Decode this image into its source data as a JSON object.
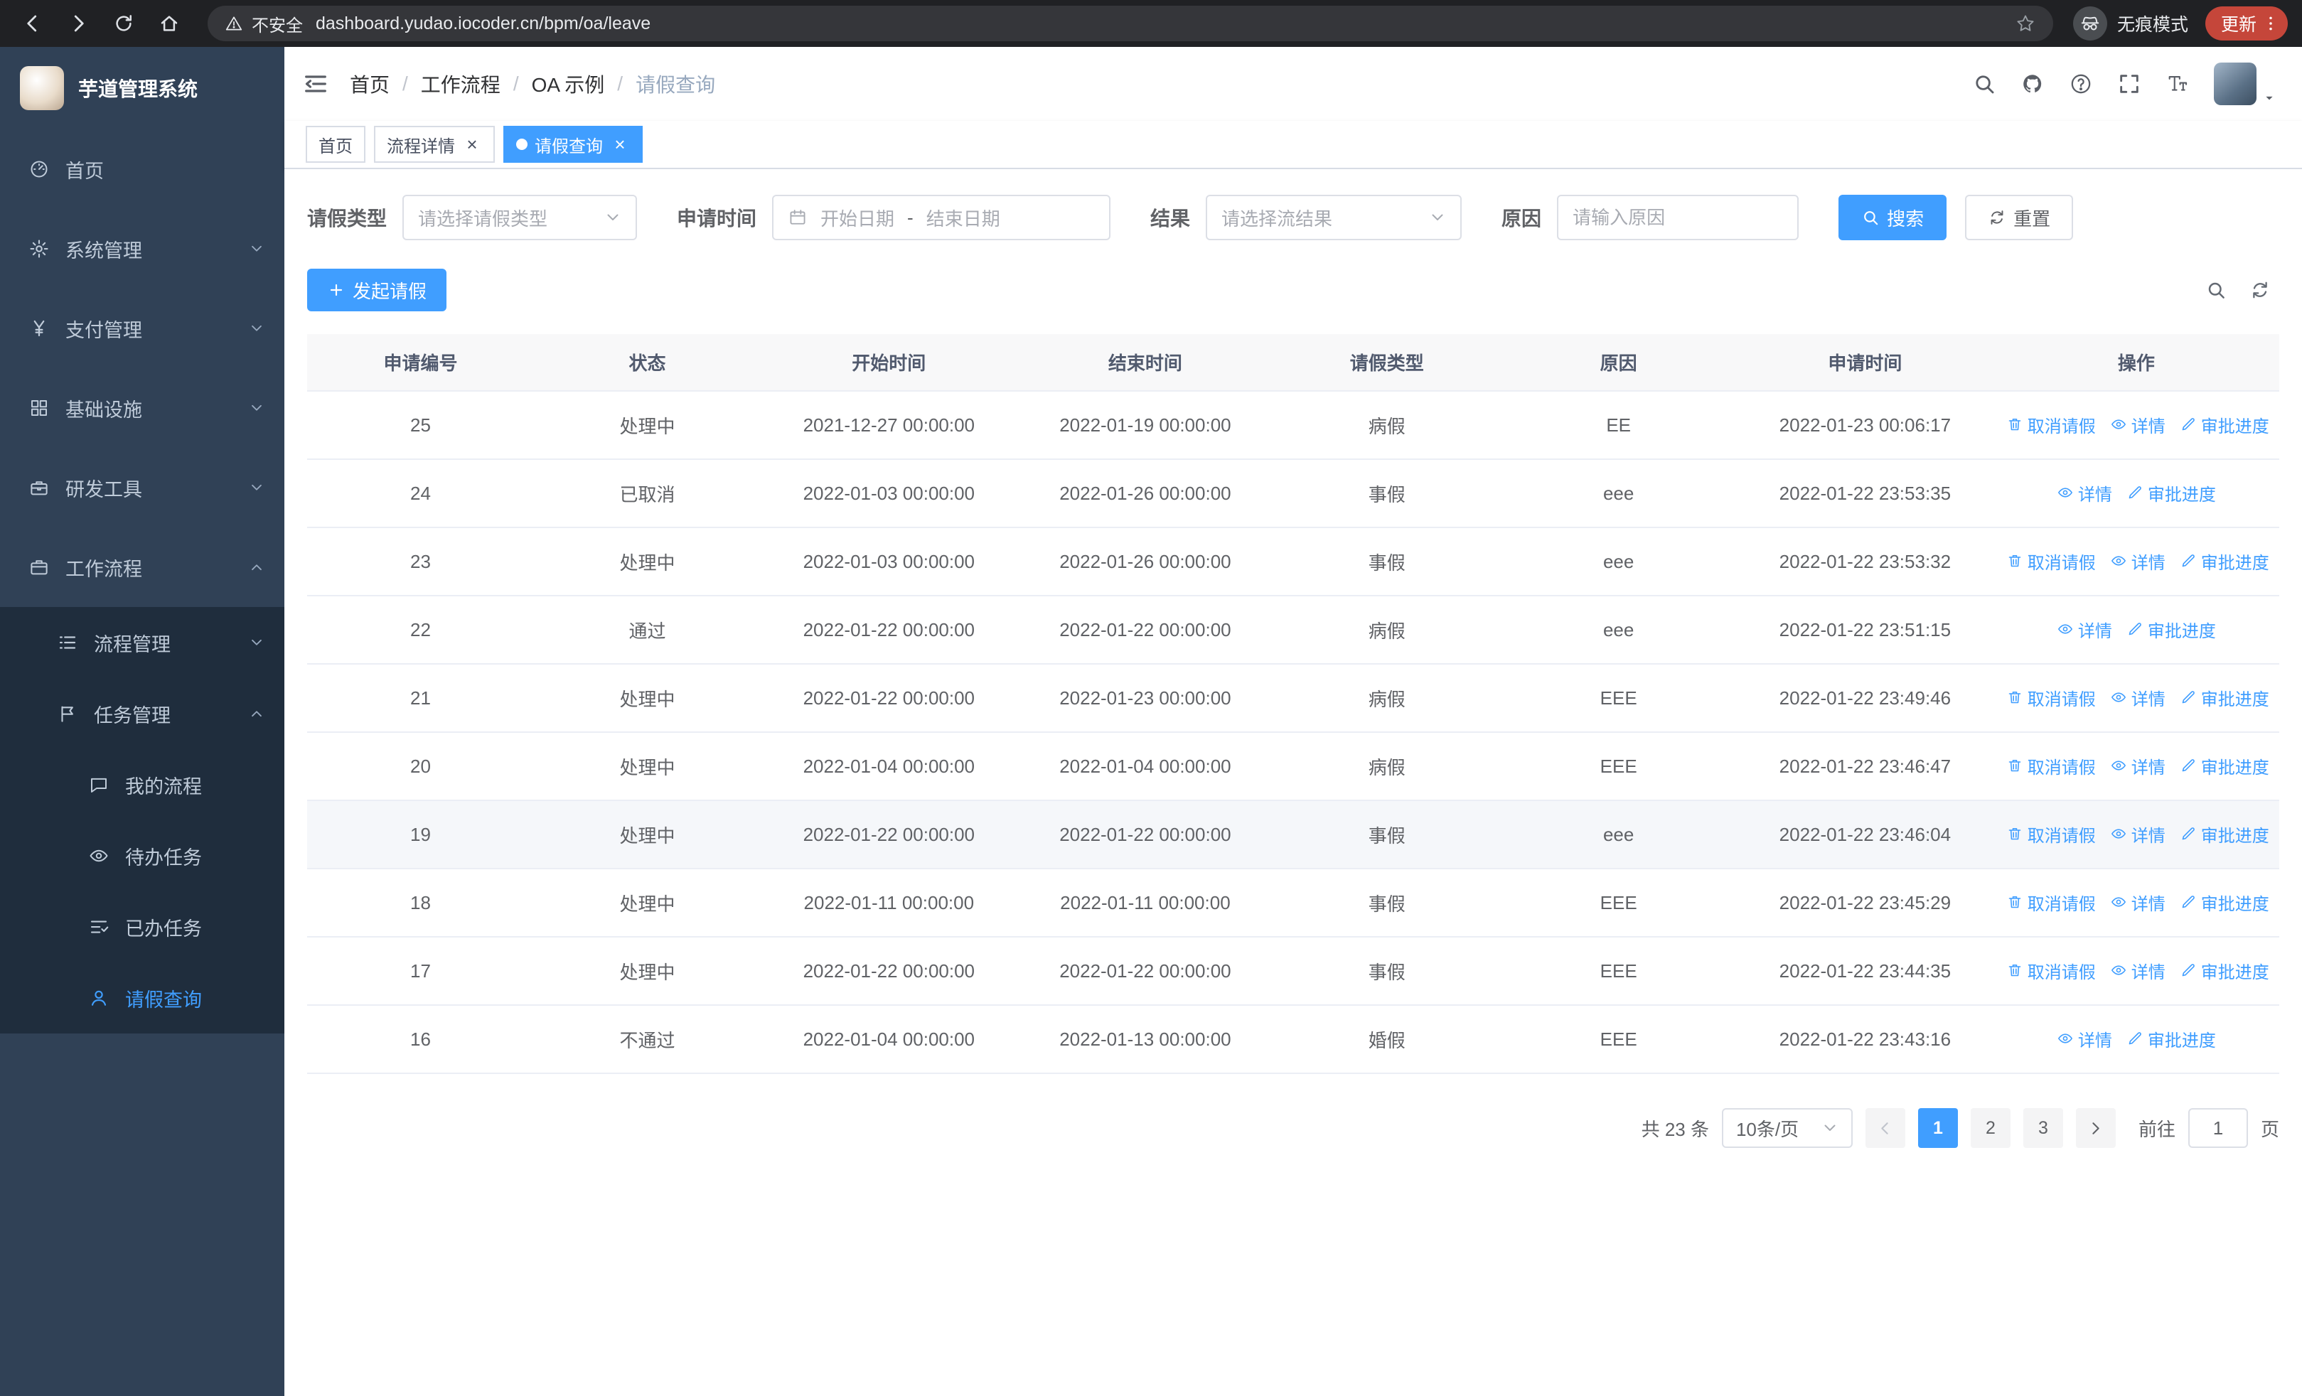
{
  "colors": {
    "primary": "#409eff",
    "sidebar_bg": "#304156",
    "sidebar_submenu_bg": "#1f2d3d",
    "update_badge_bg": "#c5463a"
  },
  "browser": {
    "security_label": "不安全",
    "url": "dashboard.yudao.iocoder.cn/bpm/oa/leave",
    "incognito_label": "无痕模式",
    "update_label": "更新"
  },
  "sidebar": {
    "app_title": "芋道管理系统",
    "menu": [
      {
        "key": "home",
        "label": "首页",
        "icon": "dashboard-icon"
      },
      {
        "key": "system",
        "label": "系统管理",
        "icon": "gear-icon",
        "chevron": "down"
      },
      {
        "key": "payment",
        "label": "支付管理",
        "icon": "yen-icon",
        "chevron": "down"
      },
      {
        "key": "infrastructure",
        "label": "基础设施",
        "icon": "grid-icon",
        "chevron": "down"
      },
      {
        "key": "dev-tools",
        "label": "研发工具",
        "icon": "toolbox-icon",
        "chevron": "down"
      },
      {
        "key": "workflow",
        "label": "工作流程",
        "icon": "briefcase-icon",
        "chevron": "up",
        "expanded": true,
        "children": [
          {
            "key": "process-management",
            "label": "流程管理",
            "icon": "list-icon",
            "chevron": "down"
          },
          {
            "key": "task-management",
            "label": "任务管理",
            "icon": "flag-icon",
            "chevron": "up",
            "expanded": true,
            "children": [
              {
                "key": "my-process",
                "label": "我的流程",
                "icon": "chat-icon"
              },
              {
                "key": "todo-task",
                "label": "待办任务",
                "icon": "eye-icon"
              },
              {
                "key": "done-task",
                "label": "已办任务",
                "icon": "done-icon"
              },
              {
                "key": "leave-query",
                "label": "请假查询",
                "icon": "user-icon",
                "active": true
              }
            ]
          }
        ]
      }
    ]
  },
  "navbar": {
    "breadcrumb": [
      {
        "label": "首页"
      },
      {
        "label": "工作流程"
      },
      {
        "label": "OA 示例"
      },
      {
        "label": "请假查询",
        "current": true
      }
    ]
  },
  "tags_view": [
    {
      "key": "home",
      "label": "首页",
      "closable": false,
      "active": false
    },
    {
      "key": "process-detail",
      "label": "流程详情",
      "closable": true,
      "active": false
    },
    {
      "key": "leave-query",
      "label": "请假查询",
      "closable": true,
      "active": true
    }
  ],
  "filters": {
    "leave_type_label": "请假类型",
    "leave_type_placeholder": "请选择请假类型",
    "apply_time_label": "申请时间",
    "start_date_placeholder": "开始日期",
    "date_separator": "-",
    "end_date_placeholder": "结束日期",
    "result_label": "结果",
    "result_placeholder": "请选择流结果",
    "reason_label": "原因",
    "reason_placeholder": "请输入原因",
    "search_label": "搜索",
    "reset_label": "重置"
  },
  "actions_bar": {
    "create_label": "发起请假"
  },
  "table": {
    "headers": [
      "申请编号",
      "状态",
      "开始时间",
      "结束时间",
      "请假类型",
      "原因",
      "申请时间",
      "操作"
    ],
    "action_labels": {
      "cancel": "取消请假",
      "detail": "详情",
      "progress": "审批进度"
    },
    "rows": [
      {
        "id": "25",
        "status": "处理中",
        "start": "2021-12-27 00:00:00",
        "end": "2022-01-19 00:00:00",
        "type": "病假",
        "reason": "EE",
        "applied": "2022-01-23 00:06:17",
        "actions": [
          "cancel",
          "detail",
          "progress"
        ]
      },
      {
        "id": "24",
        "status": "已取消",
        "start": "2022-01-03 00:00:00",
        "end": "2022-01-26 00:00:00",
        "type": "事假",
        "reason": "eee",
        "applied": "2022-01-22 23:53:35",
        "actions": [
          "detail",
          "progress"
        ]
      },
      {
        "id": "23",
        "status": "处理中",
        "start": "2022-01-03 00:00:00",
        "end": "2022-01-26 00:00:00",
        "type": "事假",
        "reason": "eee",
        "applied": "2022-01-22 23:53:32",
        "actions": [
          "cancel",
          "detail",
          "progress"
        ]
      },
      {
        "id": "22",
        "status": "通过",
        "start": "2022-01-22 00:00:00",
        "end": "2022-01-22 00:00:00",
        "type": "病假",
        "reason": "eee",
        "applied": "2022-01-22 23:51:15",
        "actions": [
          "detail",
          "progress"
        ]
      },
      {
        "id": "21",
        "status": "处理中",
        "start": "2022-01-22 00:00:00",
        "end": "2022-01-23 00:00:00",
        "type": "病假",
        "reason": "EEE",
        "applied": "2022-01-22 23:49:46",
        "actions": [
          "cancel",
          "detail",
          "progress"
        ]
      },
      {
        "id": "20",
        "status": "处理中",
        "start": "2022-01-04 00:00:00",
        "end": "2022-01-04 00:00:00",
        "type": "病假",
        "reason": "EEE",
        "applied": "2022-01-22 23:46:47",
        "actions": [
          "cancel",
          "detail",
          "progress"
        ]
      },
      {
        "id": "19",
        "status": "处理中",
        "start": "2022-01-22 00:00:00",
        "end": "2022-01-22 00:00:00",
        "type": "事假",
        "reason": "eee",
        "applied": "2022-01-22 23:46:04",
        "actions": [
          "cancel",
          "detail",
          "progress"
        ],
        "highlighted": true
      },
      {
        "id": "18",
        "status": "处理中",
        "start": "2022-01-11 00:00:00",
        "end": "2022-01-11 00:00:00",
        "type": "事假",
        "reason": "EEE",
        "applied": "2022-01-22 23:45:29",
        "actions": [
          "cancel",
          "detail",
          "progress"
        ]
      },
      {
        "id": "17",
        "status": "处理中",
        "start": "2022-01-22 00:00:00",
        "end": "2022-01-22 00:00:00",
        "type": "事假",
        "reason": "EEE",
        "applied": "2022-01-22 23:44:35",
        "actions": [
          "cancel",
          "detail",
          "progress"
        ]
      },
      {
        "id": "16",
        "status": "不通过",
        "start": "2022-01-04 00:00:00",
        "end": "2022-01-13 00:00:00",
        "type": "婚假",
        "reason": "EEE",
        "applied": "2022-01-22 23:43:16",
        "actions": [
          "detail",
          "progress"
        ]
      }
    ]
  },
  "pagination": {
    "total_label": "共 23 条",
    "page_size_label": "10条/页",
    "pages": [
      "1",
      "2",
      "3"
    ],
    "active_page": "1",
    "goto_label": "前往",
    "goto_value": "1",
    "goto_suffix": "页"
  }
}
